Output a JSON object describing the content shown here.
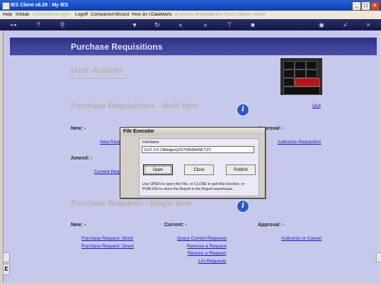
{
  "window": {
    "title": "IES Client v8.29 : My IES"
  },
  "menu": [
    {
      "label": "Help",
      "enabled": true
    },
    {
      "label": "Infolab",
      "enabled": true
    },
    {
      "label": "Connections",
      "enabled": false
    },
    {
      "label": "Logon",
      "enabled": false
    },
    {
      "label": "Logoff",
      "enabled": true
    },
    {
      "label": "Companion",
      "enabled": true
    },
    {
      "label": "Wizard",
      "enabled": true
    },
    {
      "label": "How do I",
      "enabled": true
    },
    {
      "label": "DataMarts",
      "enabled": true
    },
    {
      "label": "Business Modules",
      "enabled": false
    },
    {
      "label": "Action Focus",
      "enabled": false
    },
    {
      "label": "Option Select",
      "enabled": false
    }
  ],
  "header": {
    "title": "Purchase Requisitions"
  },
  "user_activity": "User Activity",
  "quit": "Quit",
  "section1": {
    "title": "Purchase Requisitions - Multi Item",
    "new_label": "New: -",
    "approval_label": "Approval: -",
    "amend_label": "Amend: -",
    "new_link": "New Requ",
    "current_link": "Current Requ",
    "authorize_link": "Authorize Requisition"
  },
  "section2": {
    "title": "Purchase Requests - Single Item",
    "new_label": "New: -",
    "current_label": "Current: -",
    "approval_label": "Approval: -",
    "links_new": [
      "Purchase Request: Stock",
      "Purchase Request: Direct"
    ],
    "links_current": [
      "Query Current Requests",
      "Remove a Request",
      "Restore a Request",
      "List Requests"
    ],
    "links_approval": [
      "Authorize or Cancel"
    ]
  },
  "dialog": {
    "title": "File Executor",
    "filename_label": "FileName",
    "filename_value": "\\\\127.0.0.1\\Bridge\\Q1570956449A.TXT",
    "open": "Open",
    "close": "Close",
    "publish": "Publish",
    "help_line1": "Use OPEN to open the File, or CLOSE to quit this function, or",
    "help_line2": "PUBLISH to store the Report in the Report warehouse."
  }
}
